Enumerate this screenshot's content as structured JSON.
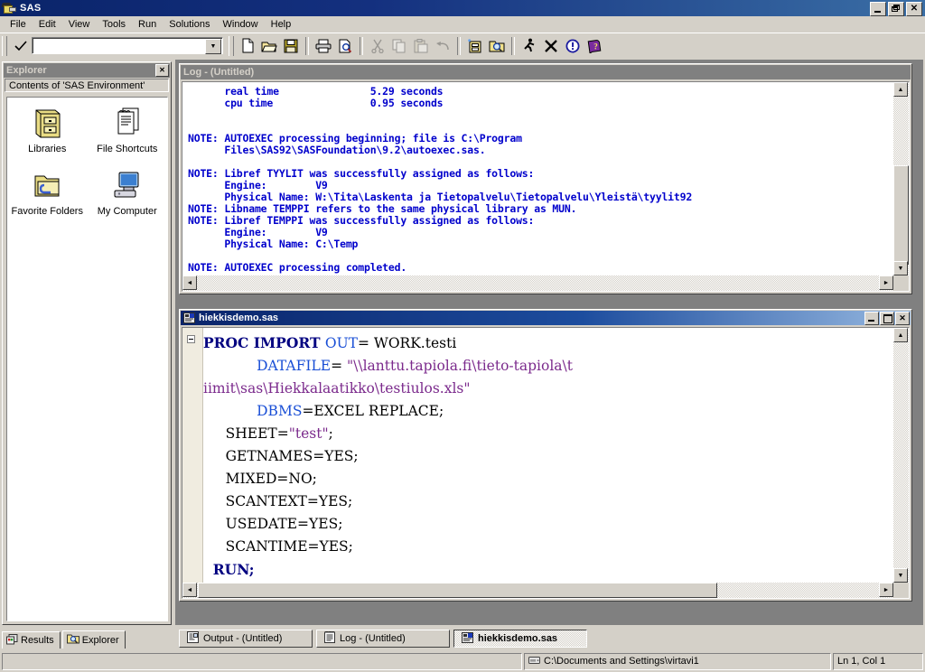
{
  "window": {
    "title": "SAS",
    "icon": "sas-app-icon",
    "controls": {
      "minimize": "minimize-icon",
      "restore": "restore-icon",
      "close": "close-icon"
    }
  },
  "menu": {
    "items": [
      {
        "label": "File"
      },
      {
        "label": "Edit"
      },
      {
        "label": "View"
      },
      {
        "label": "Tools"
      },
      {
        "label": "Run"
      },
      {
        "label": "Solutions"
      },
      {
        "label": "Window"
      },
      {
        "label": "Help"
      }
    ]
  },
  "commandbar": {
    "submit_icon": "checkmark-icon",
    "value": "",
    "placeholder": "",
    "dropdown_icon": "chevron-down-icon"
  },
  "toolbar": {
    "buttons": [
      {
        "name": "new-icon",
        "tooltip": "New"
      },
      {
        "name": "open-icon",
        "tooltip": "Open"
      },
      {
        "name": "save-icon",
        "tooltip": "Save"
      },
      {
        "name": "print-icon",
        "tooltip": "Print"
      },
      {
        "name": "print-preview-icon",
        "tooltip": "Print Preview"
      },
      {
        "name": "cut-icon",
        "tooltip": "Cut"
      },
      {
        "name": "copy-icon",
        "tooltip": "Copy"
      },
      {
        "name": "paste-icon",
        "tooltip": "Paste"
      },
      {
        "name": "undo-icon",
        "tooltip": "Undo"
      },
      {
        "name": "new-library-icon",
        "tooltip": "New Library"
      },
      {
        "name": "explorer-search-icon",
        "tooltip": "SAS Explorer"
      },
      {
        "name": "submit-run-icon",
        "tooltip": "Submit"
      },
      {
        "name": "clear-all-icon",
        "tooltip": "Clear All"
      },
      {
        "name": "break-icon",
        "tooltip": "Break"
      },
      {
        "name": "help-icon",
        "tooltip": "SAS Help"
      }
    ]
  },
  "explorer": {
    "title": "Explorer",
    "close_icon": "close-icon",
    "contents_label": "Contents of 'SAS Environment'",
    "items": [
      {
        "label": "Libraries",
        "icon": "libraries-icon"
      },
      {
        "label": "File Shortcuts",
        "icon": "file-shortcuts-icon"
      },
      {
        "label": "Favorite Folders",
        "icon": "favorite-folders-icon"
      },
      {
        "label": "My Computer",
        "icon": "my-computer-icon"
      }
    ],
    "tabs": [
      {
        "label": "Results",
        "icon": "results-icon",
        "active": false
      },
      {
        "label": "Explorer",
        "icon": "explorer-icon",
        "active": true
      }
    ]
  },
  "log_window": {
    "title": "Log - (Untitled)",
    "active": false,
    "text": "      real time               5.29 seconds\n      cpu time                0.95 seconds\n\n\nNOTE: AUTOEXEC processing beginning; file is C:\\Program\n      Files\\SAS92\\SASFoundation\\9.2\\autoexec.sas.\n\nNOTE: Libref TYYLIT was successfully assigned as follows:\n      Engine:        V9\n      Physical Name: W:\\Tita\\Laskenta ja Tietopalvelu\\Tietopalvelu\\Yleistä\\tyylit92\nNOTE: Libname TEMPPI refers to the same physical library as MUN.\nNOTE: Libref TEMPPI was successfully assigned as follows:\n      Engine:        V9\n      Physical Name: C:\\Temp\n\nNOTE: AUTOEXEC processing completed.",
    "text_color": "#0000cc",
    "scroll_up_icon": "scroll-up-icon",
    "scroll_down_icon": "scroll-down-icon",
    "scroll_left_icon": "scroll-left-icon",
    "scroll_right_icon": "scroll-right-icon"
  },
  "editor_window": {
    "title": "hiekkisdemo.sas",
    "icon": "sas-program-icon",
    "active": true,
    "collapse_icon": "collapse-minus-icon",
    "code_lines": [
      [
        {
          "t": "PROC IMPORT ",
          "c": "kw"
        },
        {
          "t": "OUT",
          "c": "opt"
        },
        {
          "t": "= WORK.testi",
          "c": "plain"
        }
      ],
      [
        {
          "t": "            ",
          "c": "plain"
        },
        {
          "t": "DATAFILE",
          "c": "opt"
        },
        {
          "t": "= ",
          "c": "plain"
        },
        {
          "t": "\"\\\\lanttu.tapiola.fi\\tieto-tapiola\\t",
          "c": "str"
        }
      ],
      [
        {
          "t": "iimit\\sas\\Hiekkalaatikko\\testiulos.xls\"",
          "c": "str"
        }
      ],
      [
        {
          "t": "            ",
          "c": "plain"
        },
        {
          "t": "DBMS",
          "c": "opt"
        },
        {
          "t": "=EXCEL REPLACE;",
          "c": "plain"
        }
      ],
      [
        {
          "t": "     SHEET=",
          "c": "plain"
        },
        {
          "t": "\"test\"",
          "c": "str"
        },
        {
          "t": ";",
          "c": "plain"
        }
      ],
      [
        {
          "t": "     GETNAMES=YES;",
          "c": "plain"
        }
      ],
      [
        {
          "t": "     MIXED=NO;",
          "c": "plain"
        }
      ],
      [
        {
          "t": "     SCANTEXT=YES;",
          "c": "plain"
        }
      ],
      [
        {
          "t": "     USEDATE=YES;",
          "c": "plain"
        }
      ],
      [
        {
          "t": "     SCANTIME=YES;",
          "c": "plain"
        }
      ],
      [
        {
          "t": "  RUN;",
          "c": "kw"
        }
      ]
    ]
  },
  "taskbar": {
    "buttons": [
      {
        "label": "Output - (Untitled)",
        "icon": "output-icon",
        "active": false
      },
      {
        "label": "Log - (Untitled)",
        "icon": "log-icon",
        "active": false
      },
      {
        "label": "hiekkisdemo.sas",
        "icon": "sas-program-icon",
        "active": true
      }
    ]
  },
  "statusbar": {
    "left": "",
    "path_icon": "drive-icon",
    "path": "C:\\Documents and Settings\\virtavi1",
    "position": "Ln 1, Col 1"
  },
  "colors": {
    "titlebar_active": "#0a246a",
    "titlebar_inactive": "#808080",
    "face": "#d4d0c8",
    "log_text": "#0000cc",
    "code_keyword": "#000080",
    "code_option": "#1a4fd6",
    "code_string": "#7b2a8c"
  }
}
